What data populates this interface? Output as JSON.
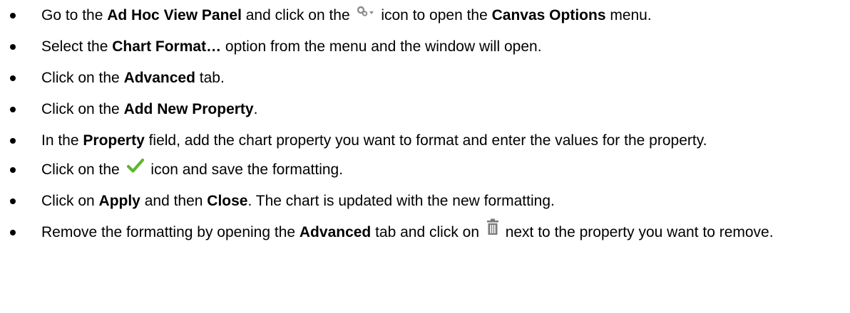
{
  "steps": [
    {
      "parts": [
        "Go to the ",
        "Ad Hoc View Panel",
        " and click on the ",
        " icon to open the ",
        "Canvas Options",
        " menu."
      ]
    },
    {
      "parts": [
        "Select the ",
        "Chart Format…",
        " option from the menu and the window will open."
      ]
    },
    {
      "parts": [
        "Click on the ",
        "Advanced",
        " tab."
      ]
    },
    {
      "parts": [
        "Click on the ",
        "Add New Property",
        "."
      ]
    },
    {
      "parts": [
        "In the ",
        "Property",
        " field, add the chart property you want to format and enter the values for the property."
      ]
    },
    {
      "parts": [
        "Click on the ",
        " icon and save the formatting."
      ]
    },
    {
      "parts": [
        "Click on ",
        "Apply",
        " and then ",
        "Close",
        ". The chart is updated with the new formatting."
      ]
    },
    {
      "parts": [
        "Remove the formatting by opening the ",
        "Advanced",
        " tab and click on ",
        " next to the property you want to remove."
      ]
    }
  ],
  "icons": {
    "canvas_options": "gear-dropdown-icon",
    "confirm": "check-icon",
    "delete": "trash-icon"
  },
  "colors": {
    "check": "#5cb82e",
    "gear": "#8c8c8c",
    "trash": "#7a7a7a"
  }
}
